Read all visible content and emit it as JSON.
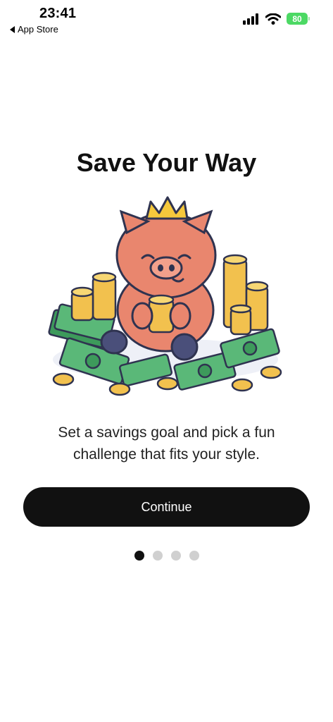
{
  "status_bar": {
    "time": "23:41",
    "back_label": "App Store",
    "battery": "80"
  },
  "onboarding": {
    "title": "Save Your Way",
    "description": "Set a savings goal and pick a fun challenge that fits your style.",
    "continue_label": "Continue",
    "page_indicator": {
      "total": 4,
      "current": 1
    }
  },
  "illustration": {
    "icon": "piggy-with-crown-and-money-icon",
    "colors": {
      "pig": "#e9866e",
      "crown": "#f5c83c",
      "coin": "#f2c14e",
      "cash": "#3d9a5b",
      "outline": "#2f3350"
    }
  }
}
